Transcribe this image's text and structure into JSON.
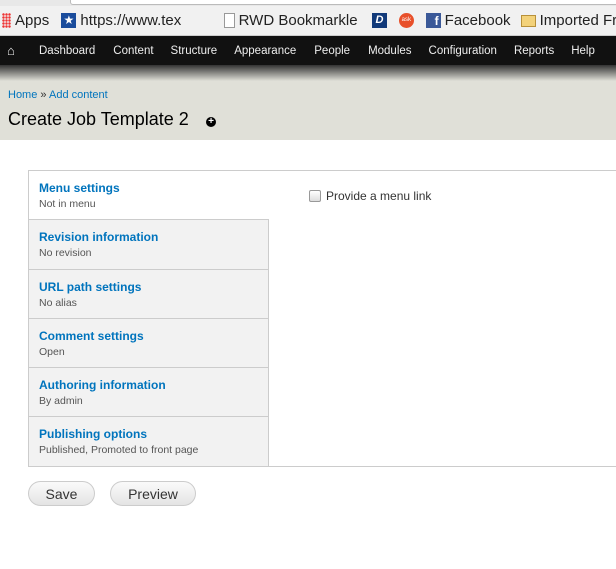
{
  "bookmarks": [
    {
      "label": "Apps",
      "icon": "apps-grid-icon"
    },
    {
      "label": "https://www.tex",
      "icon": "star-icon"
    },
    {
      "label": "RWD Bookmarkle",
      "icon": "page-icon"
    },
    {
      "label": "",
      "icon": "d-logo-icon"
    },
    {
      "label": "",
      "icon": "ask-icon"
    },
    {
      "label": "Facebook",
      "icon": "facebook-icon"
    },
    {
      "label": "Imported Fr",
      "icon": "folder-icon"
    }
  ],
  "nav": {
    "home_icon": "home-icon",
    "items": [
      "Dashboard",
      "Content",
      "Structure",
      "Appearance",
      "People",
      "Modules",
      "Configuration",
      "Reports",
      "Help"
    ]
  },
  "breadcrumb": {
    "home": "Home",
    "sep": "»",
    "add": "Add content"
  },
  "page_title": "Create Job Template 2",
  "tabs": [
    {
      "title": "Menu settings",
      "summary": "Not in menu"
    },
    {
      "title": "Revision information",
      "summary": "No revision"
    },
    {
      "title": "URL path settings",
      "summary": "No alias"
    },
    {
      "title": "Comment settings",
      "summary": "Open"
    },
    {
      "title": "Authoring information",
      "summary": "By admin"
    },
    {
      "title": "Publishing options",
      "summary": "Published, Promoted to front page"
    }
  ],
  "menu_pane": {
    "checkbox_label": "Provide a menu link",
    "checked": false
  },
  "actions": {
    "save": "Save",
    "preview": "Preview"
  },
  "colors": {
    "link": "#0074bd",
    "toolbar": "#111111",
    "header_bg": "#e0e0d8"
  }
}
